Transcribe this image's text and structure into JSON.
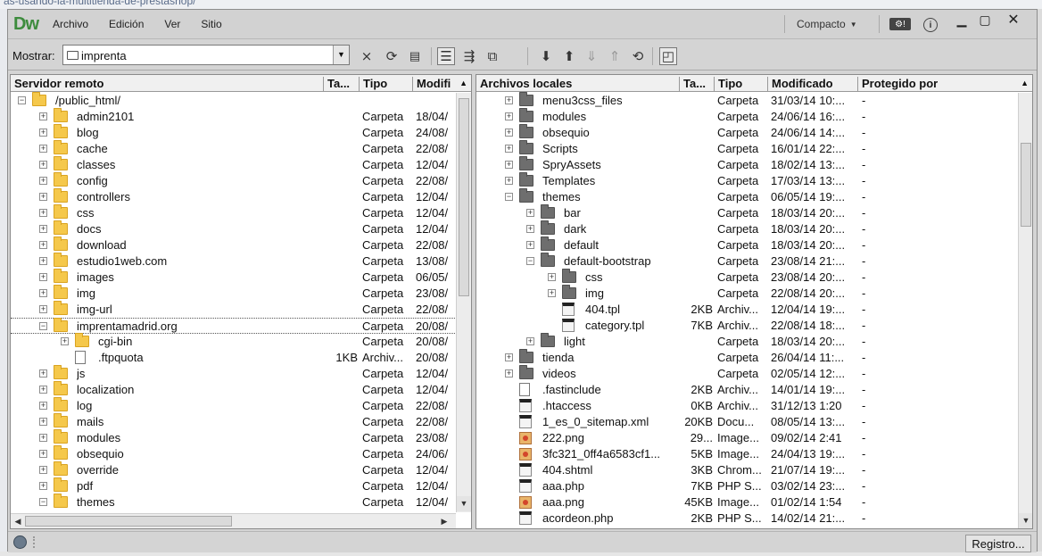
{
  "background": {
    "url_fragment": "as-usando-la-multitienda-de-prestashop/"
  },
  "app": {
    "logo": "Dw"
  },
  "menu": [
    "Archivo",
    "Edición",
    "Ver",
    "Sitio"
  ],
  "workspace": {
    "label": "Compacto"
  },
  "toolbar": {
    "show_label": "Mostrar:",
    "site_value": "imprenta"
  },
  "left": {
    "headers": [
      "Servidor remoto",
      "Ta...",
      "Tipo",
      "Modifi"
    ],
    "rows": [
      {
        "level": 0,
        "toggle": "-",
        "icon": "folder",
        "name": "/public_html/",
        "size": "",
        "type": "",
        "mod": ""
      },
      {
        "level": 1,
        "toggle": "+",
        "icon": "folder",
        "name": "admin2101",
        "size": "",
        "type": "Carpeta",
        "mod": "18/04/"
      },
      {
        "level": 1,
        "toggle": "+",
        "icon": "folder",
        "name": "blog",
        "size": "",
        "type": "Carpeta",
        "mod": "24/08/"
      },
      {
        "level": 1,
        "toggle": "+",
        "icon": "folder",
        "name": "cache",
        "size": "",
        "type": "Carpeta",
        "mod": "22/08/"
      },
      {
        "level": 1,
        "toggle": "+",
        "icon": "folder",
        "name": "classes",
        "size": "",
        "type": "Carpeta",
        "mod": "12/04/"
      },
      {
        "level": 1,
        "toggle": "+",
        "icon": "folder",
        "name": "config",
        "size": "",
        "type": "Carpeta",
        "mod": "22/08/"
      },
      {
        "level": 1,
        "toggle": "+",
        "icon": "folder",
        "name": "controllers",
        "size": "",
        "type": "Carpeta",
        "mod": "12/04/"
      },
      {
        "level": 1,
        "toggle": "+",
        "icon": "folder",
        "name": "css",
        "size": "",
        "type": "Carpeta",
        "mod": "12/04/"
      },
      {
        "level": 1,
        "toggle": "+",
        "icon": "folder",
        "name": "docs",
        "size": "",
        "type": "Carpeta",
        "mod": "12/04/"
      },
      {
        "level": 1,
        "toggle": "+",
        "icon": "folder",
        "name": "download",
        "size": "",
        "type": "Carpeta",
        "mod": "22/08/"
      },
      {
        "level": 1,
        "toggle": "+",
        "icon": "folder",
        "name": "estudio1web.com",
        "size": "",
        "type": "Carpeta",
        "mod": "13/08/"
      },
      {
        "level": 1,
        "toggle": "+",
        "icon": "folder",
        "name": "images",
        "size": "",
        "type": "Carpeta",
        "mod": "06/05/"
      },
      {
        "level": 1,
        "toggle": "+",
        "icon": "folder",
        "name": "img",
        "size": "",
        "type": "Carpeta",
        "mod": "23/08/"
      },
      {
        "level": 1,
        "toggle": "+",
        "icon": "folder",
        "name": "img-url",
        "size": "",
        "type": "Carpeta",
        "mod": "22/08/"
      },
      {
        "level": 1,
        "toggle": "-",
        "icon": "folder",
        "name": "imprentamadrid.org",
        "size": "",
        "type": "Carpeta",
        "mod": "20/08/",
        "selected": true
      },
      {
        "level": 2,
        "toggle": "+",
        "icon": "folder",
        "name": "cgi-bin",
        "size": "",
        "type": "Carpeta",
        "mod": "20/08/"
      },
      {
        "level": 2,
        "toggle": "",
        "icon": "doc",
        "name": ".ftpquota",
        "size": "1KB",
        "type": "Archiv...",
        "mod": "20/08/"
      },
      {
        "level": 1,
        "toggle": "+",
        "icon": "folder",
        "name": "js",
        "size": "",
        "type": "Carpeta",
        "mod": "12/04/"
      },
      {
        "level": 1,
        "toggle": "+",
        "icon": "folder",
        "name": "localization",
        "size": "",
        "type": "Carpeta",
        "mod": "12/04/"
      },
      {
        "level": 1,
        "toggle": "+",
        "icon": "folder",
        "name": "log",
        "size": "",
        "type": "Carpeta",
        "mod": "22/08/"
      },
      {
        "level": 1,
        "toggle": "+",
        "icon": "folder",
        "name": "mails",
        "size": "",
        "type": "Carpeta",
        "mod": "22/08/"
      },
      {
        "level": 1,
        "toggle": "+",
        "icon": "folder",
        "name": "modules",
        "size": "",
        "type": "Carpeta",
        "mod": "23/08/"
      },
      {
        "level": 1,
        "toggle": "+",
        "icon": "folder",
        "name": "obsequio",
        "size": "",
        "type": "Carpeta",
        "mod": "24/06/"
      },
      {
        "level": 1,
        "toggle": "+",
        "icon": "folder",
        "name": "override",
        "size": "",
        "type": "Carpeta",
        "mod": "12/04/"
      },
      {
        "level": 1,
        "toggle": "+",
        "icon": "folder",
        "name": "pdf",
        "size": "",
        "type": "Carpeta",
        "mod": "12/04/"
      },
      {
        "level": 1,
        "toggle": "-",
        "icon": "folder",
        "name": "themes",
        "size": "",
        "type": "Carpeta",
        "mod": "12/04/"
      }
    ]
  },
  "right": {
    "headers": [
      "Archivos locales",
      "Ta...",
      "Tipo",
      "Modificado",
      "Protegido por"
    ],
    "rows": [
      {
        "level": 0,
        "toggle": "+",
        "icon": "folder",
        "name": "menu3css_files",
        "size": "",
        "type": "Carpeta",
        "mod": "31/03/14 10:...",
        "prot": "-"
      },
      {
        "level": 0,
        "toggle": "+",
        "icon": "folder",
        "name": "modules",
        "size": "",
        "type": "Carpeta",
        "mod": "24/06/14 16:...",
        "prot": "-"
      },
      {
        "level": 0,
        "toggle": "+",
        "icon": "folder",
        "name": "obsequio",
        "size": "",
        "type": "Carpeta",
        "mod": "24/06/14 14:...",
        "prot": "-"
      },
      {
        "level": 0,
        "toggle": "+",
        "icon": "folder",
        "name": "Scripts",
        "size": "",
        "type": "Carpeta",
        "mod": "16/01/14 22:...",
        "prot": "-"
      },
      {
        "level": 0,
        "toggle": "+",
        "icon": "folder",
        "name": "SpryAssets",
        "size": "",
        "type": "Carpeta",
        "mod": "18/02/14 13:...",
        "prot": "-"
      },
      {
        "level": 0,
        "toggle": "+",
        "icon": "folder",
        "name": "Templates",
        "size": "",
        "type": "Carpeta",
        "mod": "17/03/14 13:...",
        "prot": "-"
      },
      {
        "level": 0,
        "toggle": "-",
        "icon": "folder",
        "name": "themes",
        "size": "",
        "type": "Carpeta",
        "mod": "06/05/14 19:...",
        "prot": "-"
      },
      {
        "level": 1,
        "toggle": "+",
        "icon": "folder",
        "name": "bar",
        "size": "",
        "type": "Carpeta",
        "mod": "18/03/14 20:...",
        "prot": "-"
      },
      {
        "level": 1,
        "toggle": "+",
        "icon": "folder",
        "name": "dark",
        "size": "",
        "type": "Carpeta",
        "mod": "18/03/14 20:...",
        "prot": "-"
      },
      {
        "level": 1,
        "toggle": "+",
        "icon": "folder",
        "name": "default",
        "size": "",
        "type": "Carpeta",
        "mod": "18/03/14 20:...",
        "prot": "-"
      },
      {
        "level": 1,
        "toggle": "-",
        "icon": "folder",
        "name": "default-bootstrap",
        "size": "",
        "type": "Carpeta",
        "mod": "23/08/14 21:...",
        "prot": "-"
      },
      {
        "level": 2,
        "toggle": "+",
        "icon": "folder",
        "name": "css",
        "size": "",
        "type": "Carpeta",
        "mod": "23/08/14 20:...",
        "prot": "-"
      },
      {
        "level": 2,
        "toggle": "+",
        "icon": "folder",
        "name": "img",
        "size": "",
        "type": "Carpeta",
        "mod": "22/08/14 20:...",
        "prot": "-"
      },
      {
        "level": 2,
        "toggle": "",
        "icon": "cfg",
        "name": "404.tpl",
        "size": "2KB",
        "type": "Archiv...",
        "mod": "12/04/14 19:...",
        "prot": "-"
      },
      {
        "level": 2,
        "toggle": "",
        "icon": "cfg",
        "name": "category.tpl",
        "size": "7KB",
        "type": "Archiv...",
        "mod": "22/08/14 18:...",
        "prot": "-"
      },
      {
        "level": 1,
        "toggle": "+",
        "icon": "folder",
        "name": "light",
        "size": "",
        "type": "Carpeta",
        "mod": "18/03/14 20:...",
        "prot": "-"
      },
      {
        "level": 0,
        "toggle": "+",
        "icon": "folder",
        "name": "tienda",
        "size": "",
        "type": "Carpeta",
        "mod": "26/04/14 11:...",
        "prot": "-"
      },
      {
        "level": 0,
        "toggle": "+",
        "icon": "folder",
        "name": "videos",
        "size": "",
        "type": "Carpeta",
        "mod": "02/05/14 12:...",
        "prot": "-"
      },
      {
        "level": 0,
        "toggle": "",
        "icon": "doc",
        "name": ".fastinclude",
        "size": "2KB",
        "type": "Archiv...",
        "mod": "14/01/14 19:...",
        "prot": "-"
      },
      {
        "level": 0,
        "toggle": "",
        "icon": "cfg",
        "name": ".htaccess",
        "size": "0KB",
        "type": "Archiv...",
        "mod": "31/12/13 1:20",
        "prot": "-"
      },
      {
        "level": 0,
        "toggle": "",
        "icon": "cfg",
        "name": "1_es_0_sitemap.xml",
        "size": "20KB",
        "type": "Docu...",
        "mod": "08/05/14 13:...",
        "prot": "-"
      },
      {
        "level": 0,
        "toggle": "",
        "icon": "img",
        "name": "222.png",
        "size": "29...",
        "type": "Image...",
        "mod": "09/02/14 2:41",
        "prot": "-"
      },
      {
        "level": 0,
        "toggle": "",
        "icon": "img",
        "name": "3fc321_0ff4a6583cf1...",
        "size": "5KB",
        "type": "Image...",
        "mod": "24/04/13 19:...",
        "prot": "-"
      },
      {
        "level": 0,
        "toggle": "",
        "icon": "cfg",
        "name": "404.shtml",
        "size": "3KB",
        "type": "Chrom...",
        "mod": "21/07/14 19:...",
        "prot": "-"
      },
      {
        "level": 0,
        "toggle": "",
        "icon": "cfg",
        "name": "aaa.php",
        "size": "7KB",
        "type": "PHP S...",
        "mod": "03/02/14 23:...",
        "prot": "-"
      },
      {
        "level": 0,
        "toggle": "",
        "icon": "img",
        "name": "aaa.png",
        "size": "45KB",
        "type": "Image...",
        "mod": "01/02/14 1:54",
        "prot": "-"
      },
      {
        "level": 0,
        "toggle": "",
        "icon": "cfg",
        "name": "acordeon.php",
        "size": "2KB",
        "type": "PHP S...",
        "mod": "14/02/14 21:...",
        "prot": "-"
      }
    ]
  },
  "status": {
    "log_button": "Registro..."
  },
  "colors": {
    "folder_remote": "#f5c84b",
    "folder_local": "#6e6e6e",
    "logo": "#3d8c3d"
  }
}
